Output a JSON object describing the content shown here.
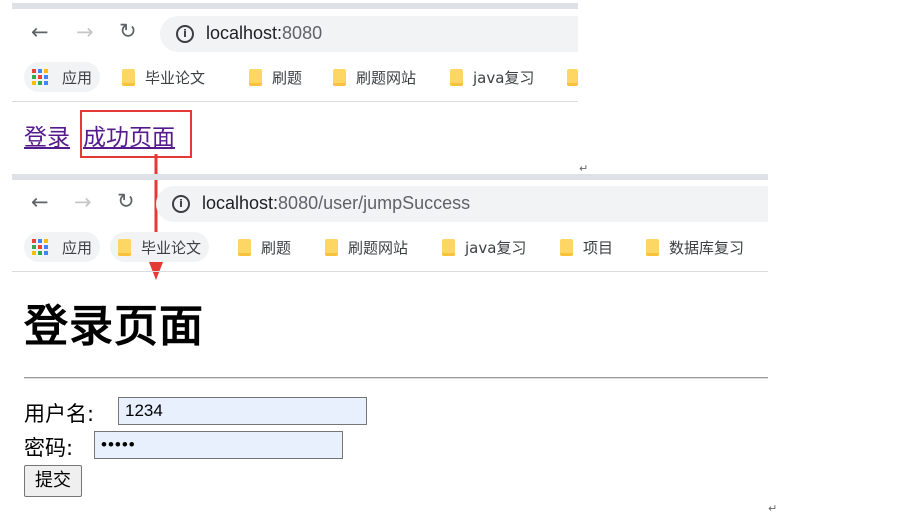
{
  "browser1": {
    "url_host": "localhost:",
    "url_rest": "8080",
    "bookmarks": [
      "应用",
      "毕业论文",
      "刷题",
      "刷题网站",
      "java复习"
    ]
  },
  "page1": {
    "links": [
      "登录",
      "成功页面"
    ]
  },
  "browser2": {
    "url_host": "localhost:",
    "url_rest": "8080/user/jumpSuccess",
    "bookmarks": [
      "应用",
      "毕业论文",
      "刷题",
      "刷题网站",
      "java复习",
      "项目",
      "数据库复习"
    ]
  },
  "page2": {
    "heading": "登录页面",
    "username_label": "用户名:",
    "username_value": "1234",
    "password_label": "密码:",
    "password_value": "•••••",
    "submit_label": "提交"
  },
  "return_mark": "↵",
  "colors": {
    "highlight": "#e53935",
    "folder": "#fdd663",
    "link": "#551a8b",
    "autofill": "#e8f0fe"
  }
}
